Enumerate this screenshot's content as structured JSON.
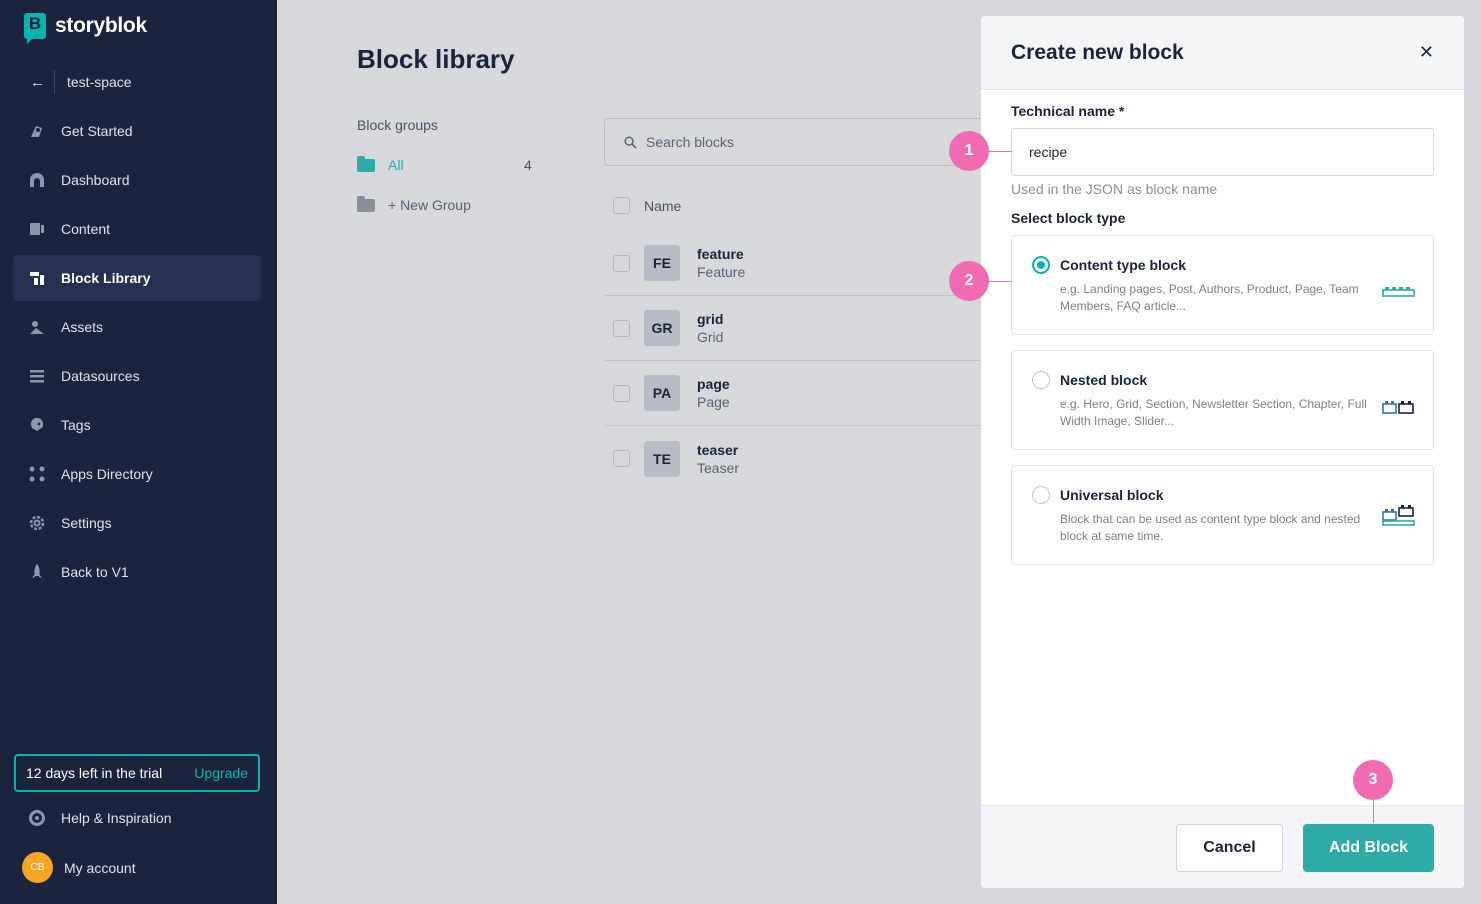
{
  "brand": {
    "name": "storyblok",
    "logo_letter": "B",
    "accent": "#09b3af"
  },
  "sidebar": {
    "space_name": "test-space",
    "items": [
      {
        "label": "Get Started",
        "icon": "rocket-hand-icon"
      },
      {
        "label": "Dashboard",
        "icon": "dashboard-icon"
      },
      {
        "label": "Content",
        "icon": "content-icon"
      },
      {
        "label": "Block Library",
        "icon": "block-library-icon",
        "active": true
      },
      {
        "label": "Assets",
        "icon": "assets-icon"
      },
      {
        "label": "Datasources",
        "icon": "datasources-icon"
      },
      {
        "label": "Tags",
        "icon": "tag-icon"
      },
      {
        "label": "Apps Directory",
        "icon": "apps-icon"
      },
      {
        "label": "Settings",
        "icon": "gear-icon"
      },
      {
        "label": "Back to V1",
        "icon": "rocket-icon"
      }
    ],
    "trial_text": "12 days left in the trial",
    "upgrade_label": "Upgrade",
    "help_label": "Help & Inspiration",
    "account_initials": "CB",
    "account_label": "My account"
  },
  "main": {
    "title": "Block library",
    "groups_label": "Block groups",
    "group_all": "All",
    "group_all_count": "4",
    "new_group": "+ New Group",
    "search_placeholder": "Search blocks",
    "name_header": "Name",
    "blocks": [
      {
        "badge": "FE",
        "name": "feature",
        "display": "Feature"
      },
      {
        "badge": "GR",
        "name": "grid",
        "display": "Grid"
      },
      {
        "badge": "PA",
        "name": "page",
        "display": "Page"
      },
      {
        "badge": "TE",
        "name": "teaser",
        "display": "Teaser"
      }
    ]
  },
  "modal": {
    "title": "Create new block",
    "technical_name_label": "Technical name *",
    "technical_name_value": "recipe",
    "technical_name_hint": "Used in the JSON as block name",
    "block_type_label": "Select block type",
    "options": [
      {
        "title": "Content type block",
        "desc": "e.g. Landing pages, Post, Authors, Product, Page, Team Members, FAQ article...",
        "selected": true
      },
      {
        "title": "Nested block",
        "desc": "e.g. Hero, Grid, Section, Newsletter Section, Chapter, Full Width Image, Slider...",
        "selected": false
      },
      {
        "title": "Universal block",
        "desc": "Block that can be used as content type block and nested block at same time.",
        "selected": false
      }
    ],
    "cancel_label": "Cancel",
    "add_label": "Add Block"
  },
  "callouts": [
    "1",
    "2",
    "3"
  ]
}
